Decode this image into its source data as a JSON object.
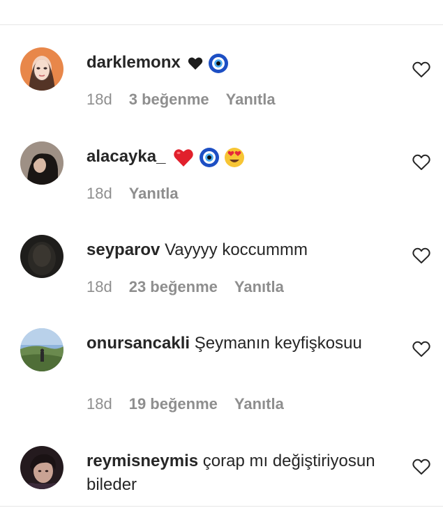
{
  "comments": [
    {
      "username": "darklemonx",
      "text": "",
      "emojis": [
        "black-heart-emoji",
        "nazar-emoji"
      ],
      "time": "18d",
      "likes": "3 beğenme",
      "reply": "Yanıtla"
    },
    {
      "username": "alacayka_",
      "text": "",
      "emojis": [
        "red-heart-emoji",
        "nazar-emoji",
        "heart-eyes-emoji"
      ],
      "time": "18d",
      "likes": "",
      "reply": "Yanıtla"
    },
    {
      "username": "seyparov",
      "text": "Vayyyy koccummm",
      "emojis": [],
      "time": "18d",
      "likes": "23 beğenme",
      "reply": "Yanıtla"
    },
    {
      "username": "onursancakli",
      "text": "Şeymanın keyfişkosuu",
      "emojis": [],
      "time": "18d",
      "likes": "19 beğenme",
      "reply": "Yanıtla"
    },
    {
      "username": "reymisneymis",
      "text": "çorap mı değiştiriyosun bileder",
      "emojis": [],
      "time": "",
      "likes": "",
      "reply": ""
    }
  ],
  "icons": {
    "like": "heart-outline-icon"
  },
  "colors": {
    "text": "#262626",
    "meta": "#8e8e8e",
    "divider": "#e6e6e6"
  }
}
